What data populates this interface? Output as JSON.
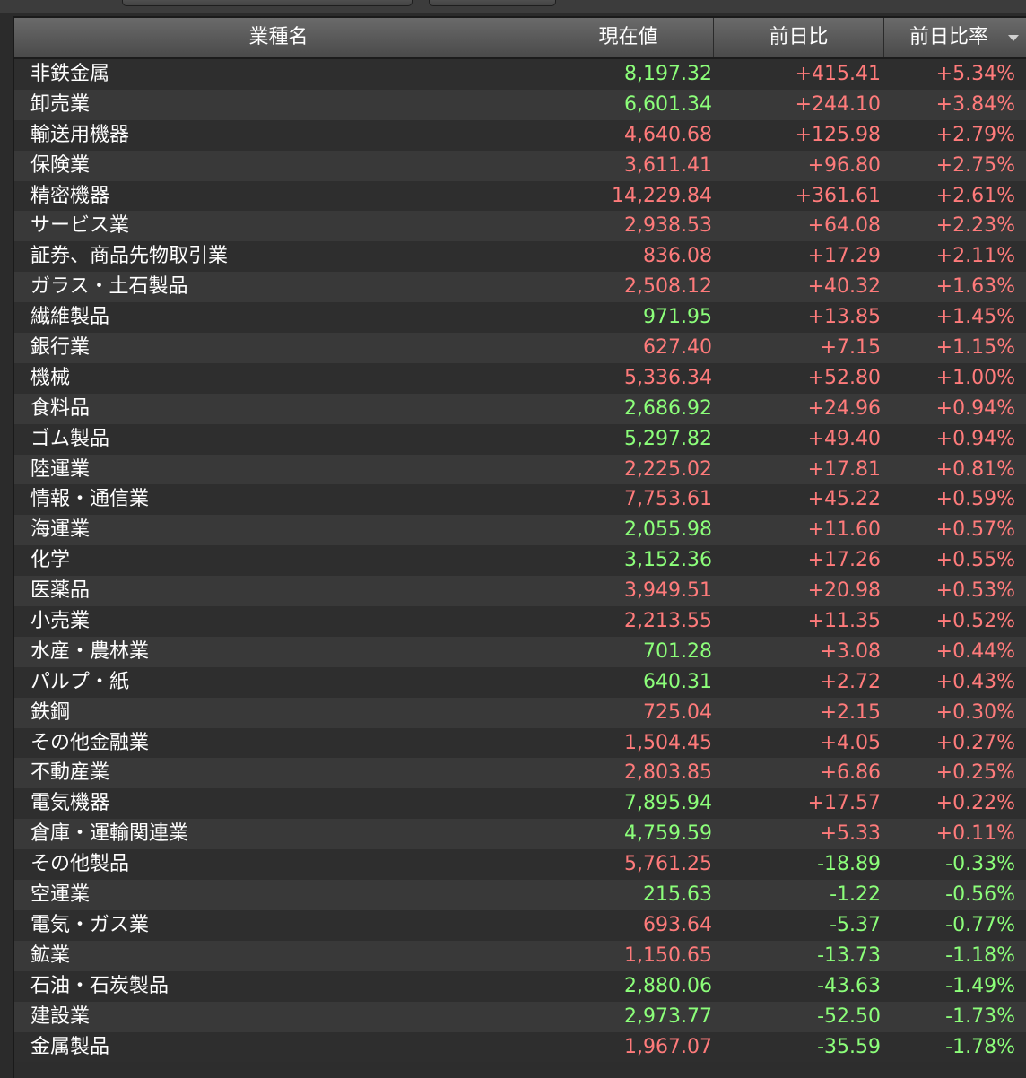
{
  "colors": {
    "up": "#ff7b7b",
    "down": "#8cff7a",
    "background": "#2b2b2b",
    "header": "#5a5a5a"
  },
  "header": {
    "name": "業種名",
    "price": "現在値",
    "diff": "前日比",
    "pct": "前日比率",
    "sort_icon": "sort-desc-icon"
  },
  "rows": [
    {
      "name": "非鉄金属",
      "price": "8,197.32",
      "price_color": "green",
      "diff": "+415.41",
      "pct": "+5.34%"
    },
    {
      "name": "卸売業",
      "price": "6,601.34",
      "price_color": "green",
      "diff": "+244.10",
      "pct": "+3.84%"
    },
    {
      "name": "輸送用機器",
      "price": "4,640.68",
      "price_color": "red",
      "diff": "+125.98",
      "pct": "+2.79%"
    },
    {
      "name": "保険業",
      "price": "3,611.41",
      "price_color": "red",
      "diff": "+96.80",
      "pct": "+2.75%"
    },
    {
      "name": "精密機器",
      "price": "14,229.84",
      "price_color": "red",
      "diff": "+361.61",
      "pct": "+2.61%"
    },
    {
      "name": "サービス業",
      "price": "2,938.53",
      "price_color": "red",
      "diff": "+64.08",
      "pct": "+2.23%"
    },
    {
      "name": "証券、商品先物取引業",
      "price": "836.08",
      "price_color": "red",
      "diff": "+17.29",
      "pct": "+2.11%"
    },
    {
      "name": "ガラス・土石製品",
      "price": "2,508.12",
      "price_color": "red",
      "diff": "+40.32",
      "pct": "+1.63%"
    },
    {
      "name": "繊維製品",
      "price": "971.95",
      "price_color": "green",
      "diff": "+13.85",
      "pct": "+1.45%"
    },
    {
      "name": "銀行業",
      "price": "627.40",
      "price_color": "red",
      "diff": "+7.15",
      "pct": "+1.15%"
    },
    {
      "name": "機械",
      "price": "5,336.34",
      "price_color": "red",
      "diff": "+52.80",
      "pct": "+1.00%"
    },
    {
      "name": "食料品",
      "price": "2,686.92",
      "price_color": "green",
      "diff": "+24.96",
      "pct": "+0.94%"
    },
    {
      "name": "ゴム製品",
      "price": "5,297.82",
      "price_color": "green",
      "diff": "+49.40",
      "pct": "+0.94%"
    },
    {
      "name": "陸運業",
      "price": "2,225.02",
      "price_color": "red",
      "diff": "+17.81",
      "pct": "+0.81%"
    },
    {
      "name": "情報・通信業",
      "price": "7,753.61",
      "price_color": "red",
      "diff": "+45.22",
      "pct": "+0.59%"
    },
    {
      "name": "海運業",
      "price": "2,055.98",
      "price_color": "green",
      "diff": "+11.60",
      "pct": "+0.57%"
    },
    {
      "name": "化学",
      "price": "3,152.36",
      "price_color": "green",
      "diff": "+17.26",
      "pct": "+0.55%"
    },
    {
      "name": "医薬品",
      "price": "3,949.51",
      "price_color": "red",
      "diff": "+20.98",
      "pct": "+0.53%"
    },
    {
      "name": "小売業",
      "price": "2,213.55",
      "price_color": "red",
      "diff": "+11.35",
      "pct": "+0.52%"
    },
    {
      "name": "水産・農林業",
      "price": "701.28",
      "price_color": "green",
      "diff": "+3.08",
      "pct": "+0.44%"
    },
    {
      "name": "パルプ・紙",
      "price": "640.31",
      "price_color": "green",
      "diff": "+2.72",
      "pct": "+0.43%"
    },
    {
      "name": "鉄鋼",
      "price": "725.04",
      "price_color": "red",
      "diff": "+2.15",
      "pct": "+0.30%"
    },
    {
      "name": "その他金融業",
      "price": "1,504.45",
      "price_color": "red",
      "diff": "+4.05",
      "pct": "+0.27%"
    },
    {
      "name": "不動産業",
      "price": "2,803.85",
      "price_color": "red",
      "diff": "+6.86",
      "pct": "+0.25%"
    },
    {
      "name": "電気機器",
      "price": "7,895.94",
      "price_color": "green",
      "diff": "+17.57",
      "pct": "+0.22%"
    },
    {
      "name": "倉庫・運輸関連業",
      "price": "4,759.59",
      "price_color": "green",
      "diff": "+5.33",
      "pct": "+0.11%"
    },
    {
      "name": "その他製品",
      "price": "5,761.25",
      "price_color": "red",
      "diff": "-18.89",
      "pct": "-0.33%"
    },
    {
      "name": "空運業",
      "price": "215.63",
      "price_color": "green",
      "diff": "-1.22",
      "pct": "-0.56%"
    },
    {
      "name": "電気・ガス業",
      "price": "693.64",
      "price_color": "red",
      "diff": "-5.37",
      "pct": "-0.77%"
    },
    {
      "name": "鉱業",
      "price": "1,150.65",
      "price_color": "red",
      "diff": "-13.73",
      "pct": "-1.18%"
    },
    {
      "name": "石油・石炭製品",
      "price": "2,880.06",
      "price_color": "green",
      "diff": "-43.63",
      "pct": "-1.49%"
    },
    {
      "name": "建設業",
      "price": "2,973.77",
      "price_color": "green",
      "diff": "-52.50",
      "pct": "-1.73%"
    },
    {
      "name": "金属製品",
      "price": "1,967.07",
      "price_color": "red",
      "diff": "-35.59",
      "pct": "-1.78%"
    }
  ]
}
